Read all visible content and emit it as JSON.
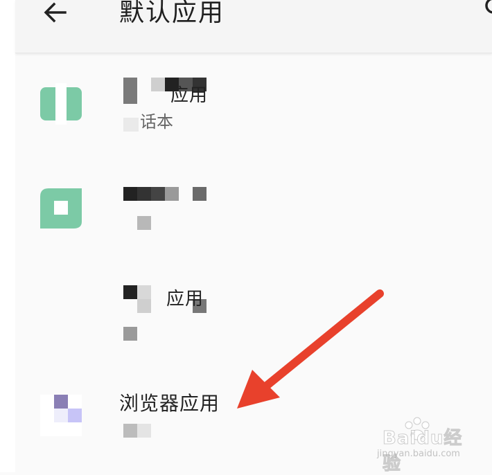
{
  "header": {
    "title": "默认应用",
    "back_icon": "arrow-left-icon",
    "search_icon": "search-icon"
  },
  "rows": [
    {
      "title": "应用",
      "subtitle": "话本",
      "icon": "app-icon"
    },
    {
      "title": "",
      "subtitle": "",
      "icon": "app-icon"
    },
    {
      "title": "应用",
      "subtitle": "",
      "icon": "none"
    },
    {
      "title": "浏览器应用",
      "subtitle": "",
      "icon": "browser-icon"
    }
  ],
  "watermark": {
    "brand": "Baidu经验",
    "url": "jingyan.baidu.com"
  },
  "colors": {
    "accent_green": "#7ccaa6",
    "arrow_red": "#e8412c",
    "browser_purple": "#8a7fb5"
  }
}
